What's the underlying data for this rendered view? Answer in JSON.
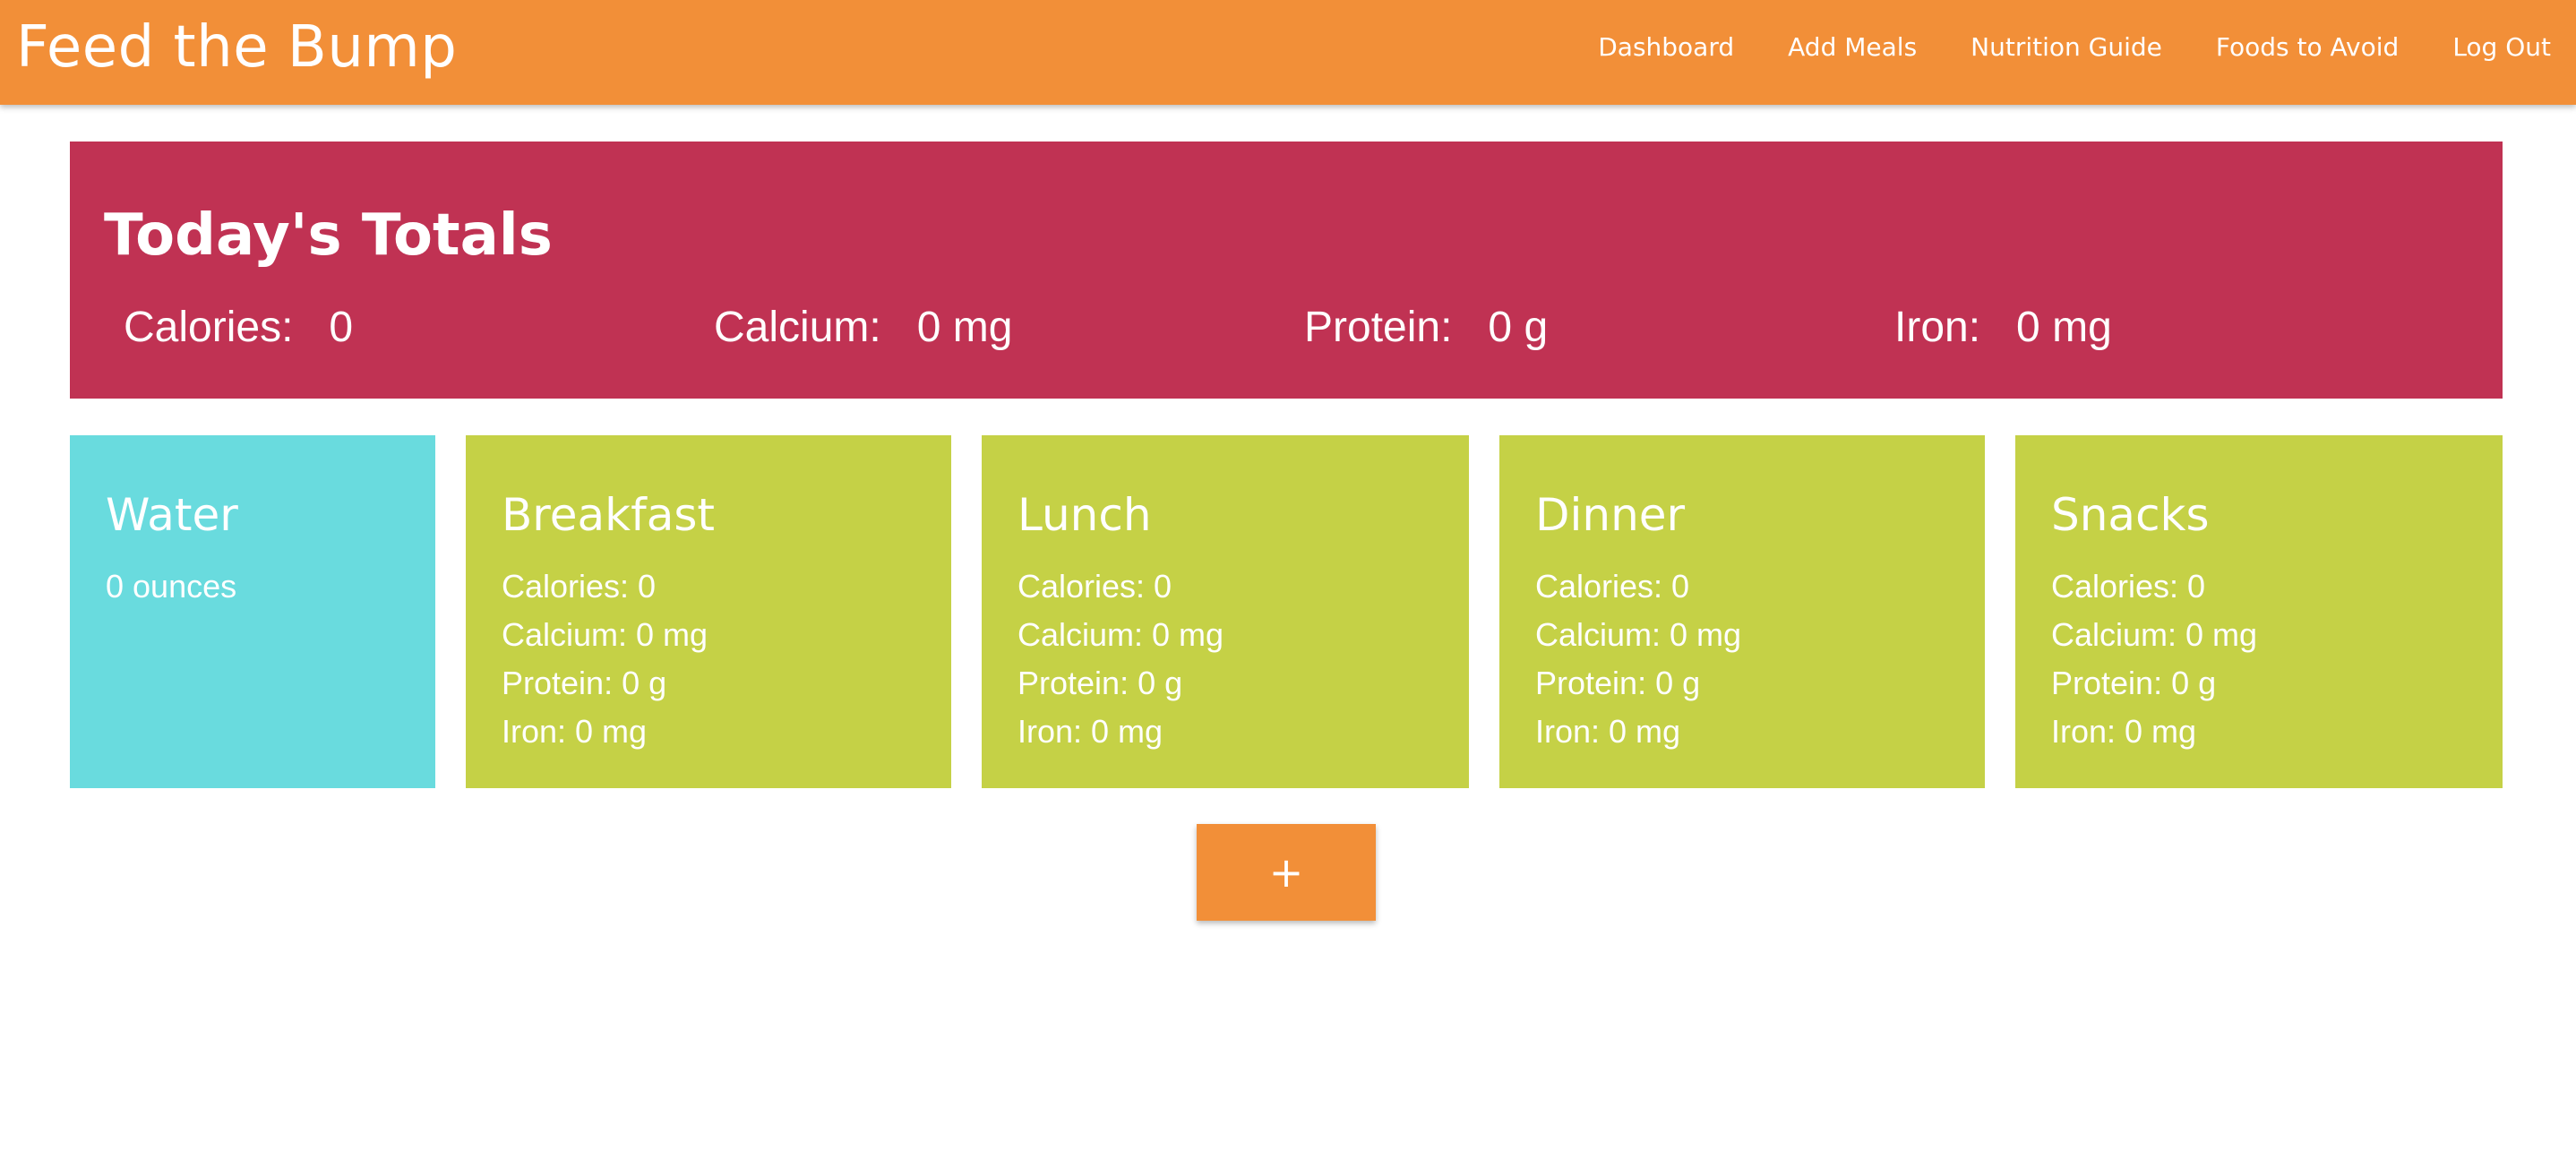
{
  "app": {
    "title": "Feed the Bump"
  },
  "nav": {
    "items": [
      {
        "label": "Dashboard"
      },
      {
        "label": "Add Meals"
      },
      {
        "label": "Nutrition Guide"
      },
      {
        "label": "Foods to Avoid"
      },
      {
        "label": "Log Out"
      }
    ]
  },
  "totals": {
    "title": "Today's Totals",
    "calories": {
      "label": "Calories:",
      "value": "0"
    },
    "calcium": {
      "label": "Calcium:",
      "value": "0 mg"
    },
    "protein": {
      "label": "Protein:",
      "value": "0 g"
    },
    "iron": {
      "label": "Iron:",
      "value": "0 mg"
    }
  },
  "water": {
    "title": "Water",
    "amount": "0 ounces"
  },
  "meals": [
    {
      "title": "Breakfast",
      "calories": "Calories: 0",
      "calcium": "Calcium: 0 mg",
      "protein": "Protein: 0 g",
      "iron": "Iron: 0 mg"
    },
    {
      "title": "Lunch",
      "calories": "Calories: 0",
      "calcium": "Calcium: 0 mg",
      "protein": "Protein: 0 g",
      "iron": "Iron: 0 mg"
    },
    {
      "title": "Dinner",
      "calories": "Calories: 0",
      "calcium": "Calcium: 0 mg",
      "protein": "Protein: 0 g",
      "iron": "Iron: 0 mg"
    },
    {
      "title": "Snacks",
      "calories": "Calories: 0",
      "calcium": "Calcium: 0 mg",
      "protein": "Protein: 0 g",
      "iron": "Iron: 0 mg"
    }
  ],
  "add_button": {
    "label": "+",
    "icon": "plus-icon"
  },
  "colors": {
    "navbar": "#f28f38",
    "totals_panel": "#c03253",
    "water_card": "#69dbde",
    "meal_card": "#c5d146",
    "add_button": "#f28f38"
  }
}
